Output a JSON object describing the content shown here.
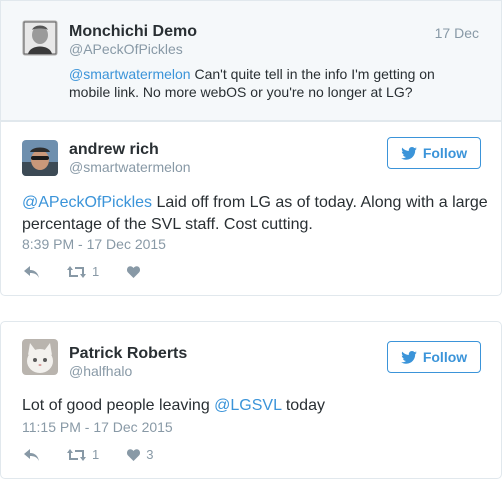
{
  "colors": {
    "link": "#3b94d9",
    "muted": "#8899a6",
    "text": "#292f33"
  },
  "parent_tweet": {
    "name": "Monchichi Demo",
    "handle": "@APeckOfPickles",
    "date": "17 Dec",
    "mention": "@smartwatermelon",
    "text_line1": " Can't quite tell in the info I'm getting on",
    "text_line2": "mobile link. No more webOS or you're no longer at LG?"
  },
  "tweets": [
    {
      "name": "andrew rich",
      "handle": "@smartwatermelon",
      "follow_label": "Follow",
      "mention": "@APeckOfPickles",
      "text_line1": " Laid off from LG as of today. Along with a large",
      "text_line2": "percentage of the SVL staff. Cost cutting.",
      "timestamp": "8:39 PM - 17 Dec 2015",
      "retweets": "1",
      "likes": ""
    },
    {
      "name": "Patrick Roberts",
      "handle": "@halfhalo",
      "follow_label": "Follow",
      "text_before": "Lot of good people leaving ",
      "mention": "@LGSVL",
      "text_after": " today",
      "timestamp": "11:15 PM - 17 Dec 2015",
      "retweets": "1",
      "likes": "3"
    }
  ]
}
